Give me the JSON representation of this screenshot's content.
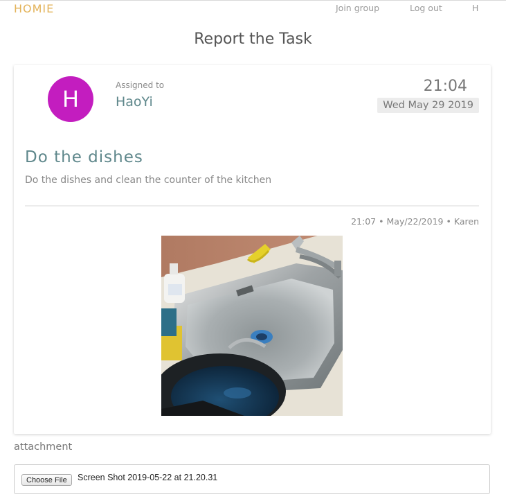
{
  "nav": {
    "brand": "HOMIE",
    "join_group": "Join group",
    "log_out": "Log out",
    "user_initial": "H"
  },
  "page": {
    "title": "Report the Task"
  },
  "task": {
    "avatar_initial": "H",
    "avatar_color": "#c31dbf",
    "assigned_label": "Assigned to",
    "assignee": "HaoYi",
    "time": "21:04",
    "date": "Wed May 29 2019",
    "title": "Do the dishes",
    "description": "Do the dishes and clean the counter of the kitchen"
  },
  "report": {
    "time": "21:07",
    "date": "May/22/2019",
    "author": "Karen",
    "separator": "•"
  },
  "attachment": {
    "label": "attachment",
    "button_label": "Choose File",
    "file_name": "Screen Shot 2019-05-22 at 21.20.31"
  },
  "colors": {
    "brand": "#e3b35a",
    "accent": "#5e878b"
  }
}
